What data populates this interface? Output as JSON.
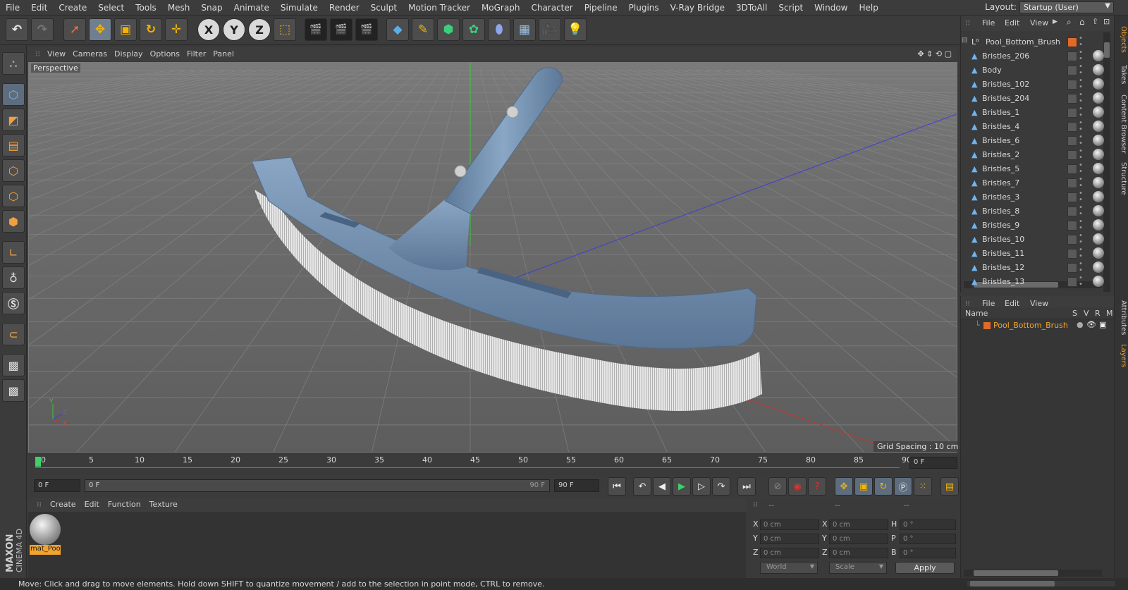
{
  "menu": [
    "File",
    "Edit",
    "Create",
    "Select",
    "Tools",
    "Mesh",
    "Snap",
    "Animate",
    "Simulate",
    "Render",
    "Sculpt",
    "Motion Tracker",
    "MoGraph",
    "Character",
    "Pipeline",
    "Plugins",
    "V-Ray Bridge",
    "3DToAll",
    "Script",
    "Window",
    "Help"
  ],
  "layout": {
    "label": "Layout:",
    "value": "Startup (User)"
  },
  "toolbar": {
    "undo": "↶",
    "redo": "↷",
    "x_axis": "X",
    "y_axis": "Y",
    "z_axis": "Z"
  },
  "viewport": {
    "menu": [
      "View",
      "Cameras",
      "Display",
      "Options",
      "Filter",
      "Panel"
    ],
    "label": "Perspective",
    "grid_spacing": "Grid Spacing : 10 cm",
    "axis": {
      "y": "Y",
      "z": "Z",
      "x": "X"
    }
  },
  "timeline": {
    "ticks": [
      "0",
      "5",
      "10",
      "15",
      "20",
      "25",
      "30",
      "35",
      "40",
      "45",
      "50",
      "55",
      "60",
      "65",
      "70",
      "75",
      "80",
      "85",
      "90"
    ],
    "current_frame": "0 F",
    "start_field": "0 F",
    "range_start": "0 F",
    "range_end": "90 F",
    "end_field": "90 F"
  },
  "material_manager": {
    "menu": [
      "Create",
      "Edit",
      "Function",
      "Texture"
    ],
    "material_name": "mat_Poo"
  },
  "coordinates": {
    "header_left": "--",
    "header_mid": "--",
    "header_right": "--",
    "rows": [
      {
        "a": "X",
        "av": "0 cm",
        "b": "X",
        "bv": "0 cm",
        "c": "H",
        "cv": "0 °"
      },
      {
        "a": "Y",
        "av": "0 cm",
        "b": "Y",
        "bv": "0 cm",
        "c": "P",
        "cv": "0 °"
      },
      {
        "a": "Z",
        "av": "0 cm",
        "b": "Z",
        "bv": "0 cm",
        "c": "B",
        "cv": "0 °"
      }
    ],
    "world_label": "World",
    "scale_label": "Scale",
    "apply_label": "Apply"
  },
  "status": "Move: Click and drag to move elements. Hold down SHIFT to quantize movement / add to the selection in point mode, CTRL to remove.",
  "objects_panel": {
    "menu": [
      "File",
      "Edit",
      "View"
    ],
    "root": "Pool_Bottom_Brush",
    "children": [
      "Bristles_206",
      "Body",
      "Bristles_102",
      "Bristles_204",
      "Bristles_1",
      "Bristles_4",
      "Bristles_6",
      "Bristles_2",
      "Bristles_5",
      "Bristles_7",
      "Bristles_3",
      "Bristles_8",
      "Bristles_9",
      "Bristles_10",
      "Bristles_11",
      "Bristles_12",
      "Bristles_13"
    ]
  },
  "layers_panel": {
    "menu": [
      "File",
      "Edit",
      "View"
    ],
    "columns": {
      "name": "Name",
      "s": "S",
      "v": "V",
      "r": "R",
      "m": "M"
    },
    "layer": "Pool_Bottom_Brush"
  },
  "right_tabs": [
    "Objects",
    "Takes",
    "Content Browser",
    "Structure",
    "Attributes",
    "Layers"
  ],
  "brand": {
    "maxon": "MAXON",
    "cinema": "CINEMA 4D"
  },
  "colors": {
    "accent": "#f2a430",
    "selection": "#5b7fa8",
    "brush": "#6e8aa8",
    "bristle": "#e8e8e8"
  }
}
